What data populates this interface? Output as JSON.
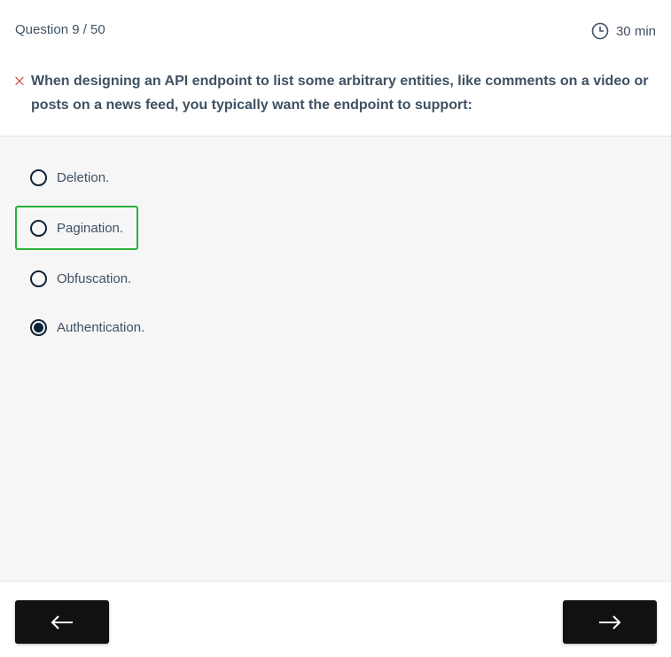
{
  "header": {
    "question_counter": "Question 9 / 50",
    "timer": "30 min",
    "question": "When designing an API endpoint to list some arbitrary entities, like comments on a video or posts on a news feed, you typically want the endpoint to support:",
    "result_icon": "x-icon"
  },
  "options": [
    {
      "label": "Deletion.",
      "selected": false,
      "correct": false
    },
    {
      "label": "Pagination.",
      "selected": false,
      "correct": true
    },
    {
      "label": "Obfuscation.",
      "selected": false,
      "correct": false
    },
    {
      "label": "Authentication.",
      "selected": true,
      "correct": false
    }
  ],
  "footer": {
    "prev_icon": "arrow-left-icon",
    "next_icon": "arrow-right-icon"
  },
  "colors": {
    "correct": "#2ab03a",
    "wrong": "#d0343a",
    "button": "#111111"
  }
}
